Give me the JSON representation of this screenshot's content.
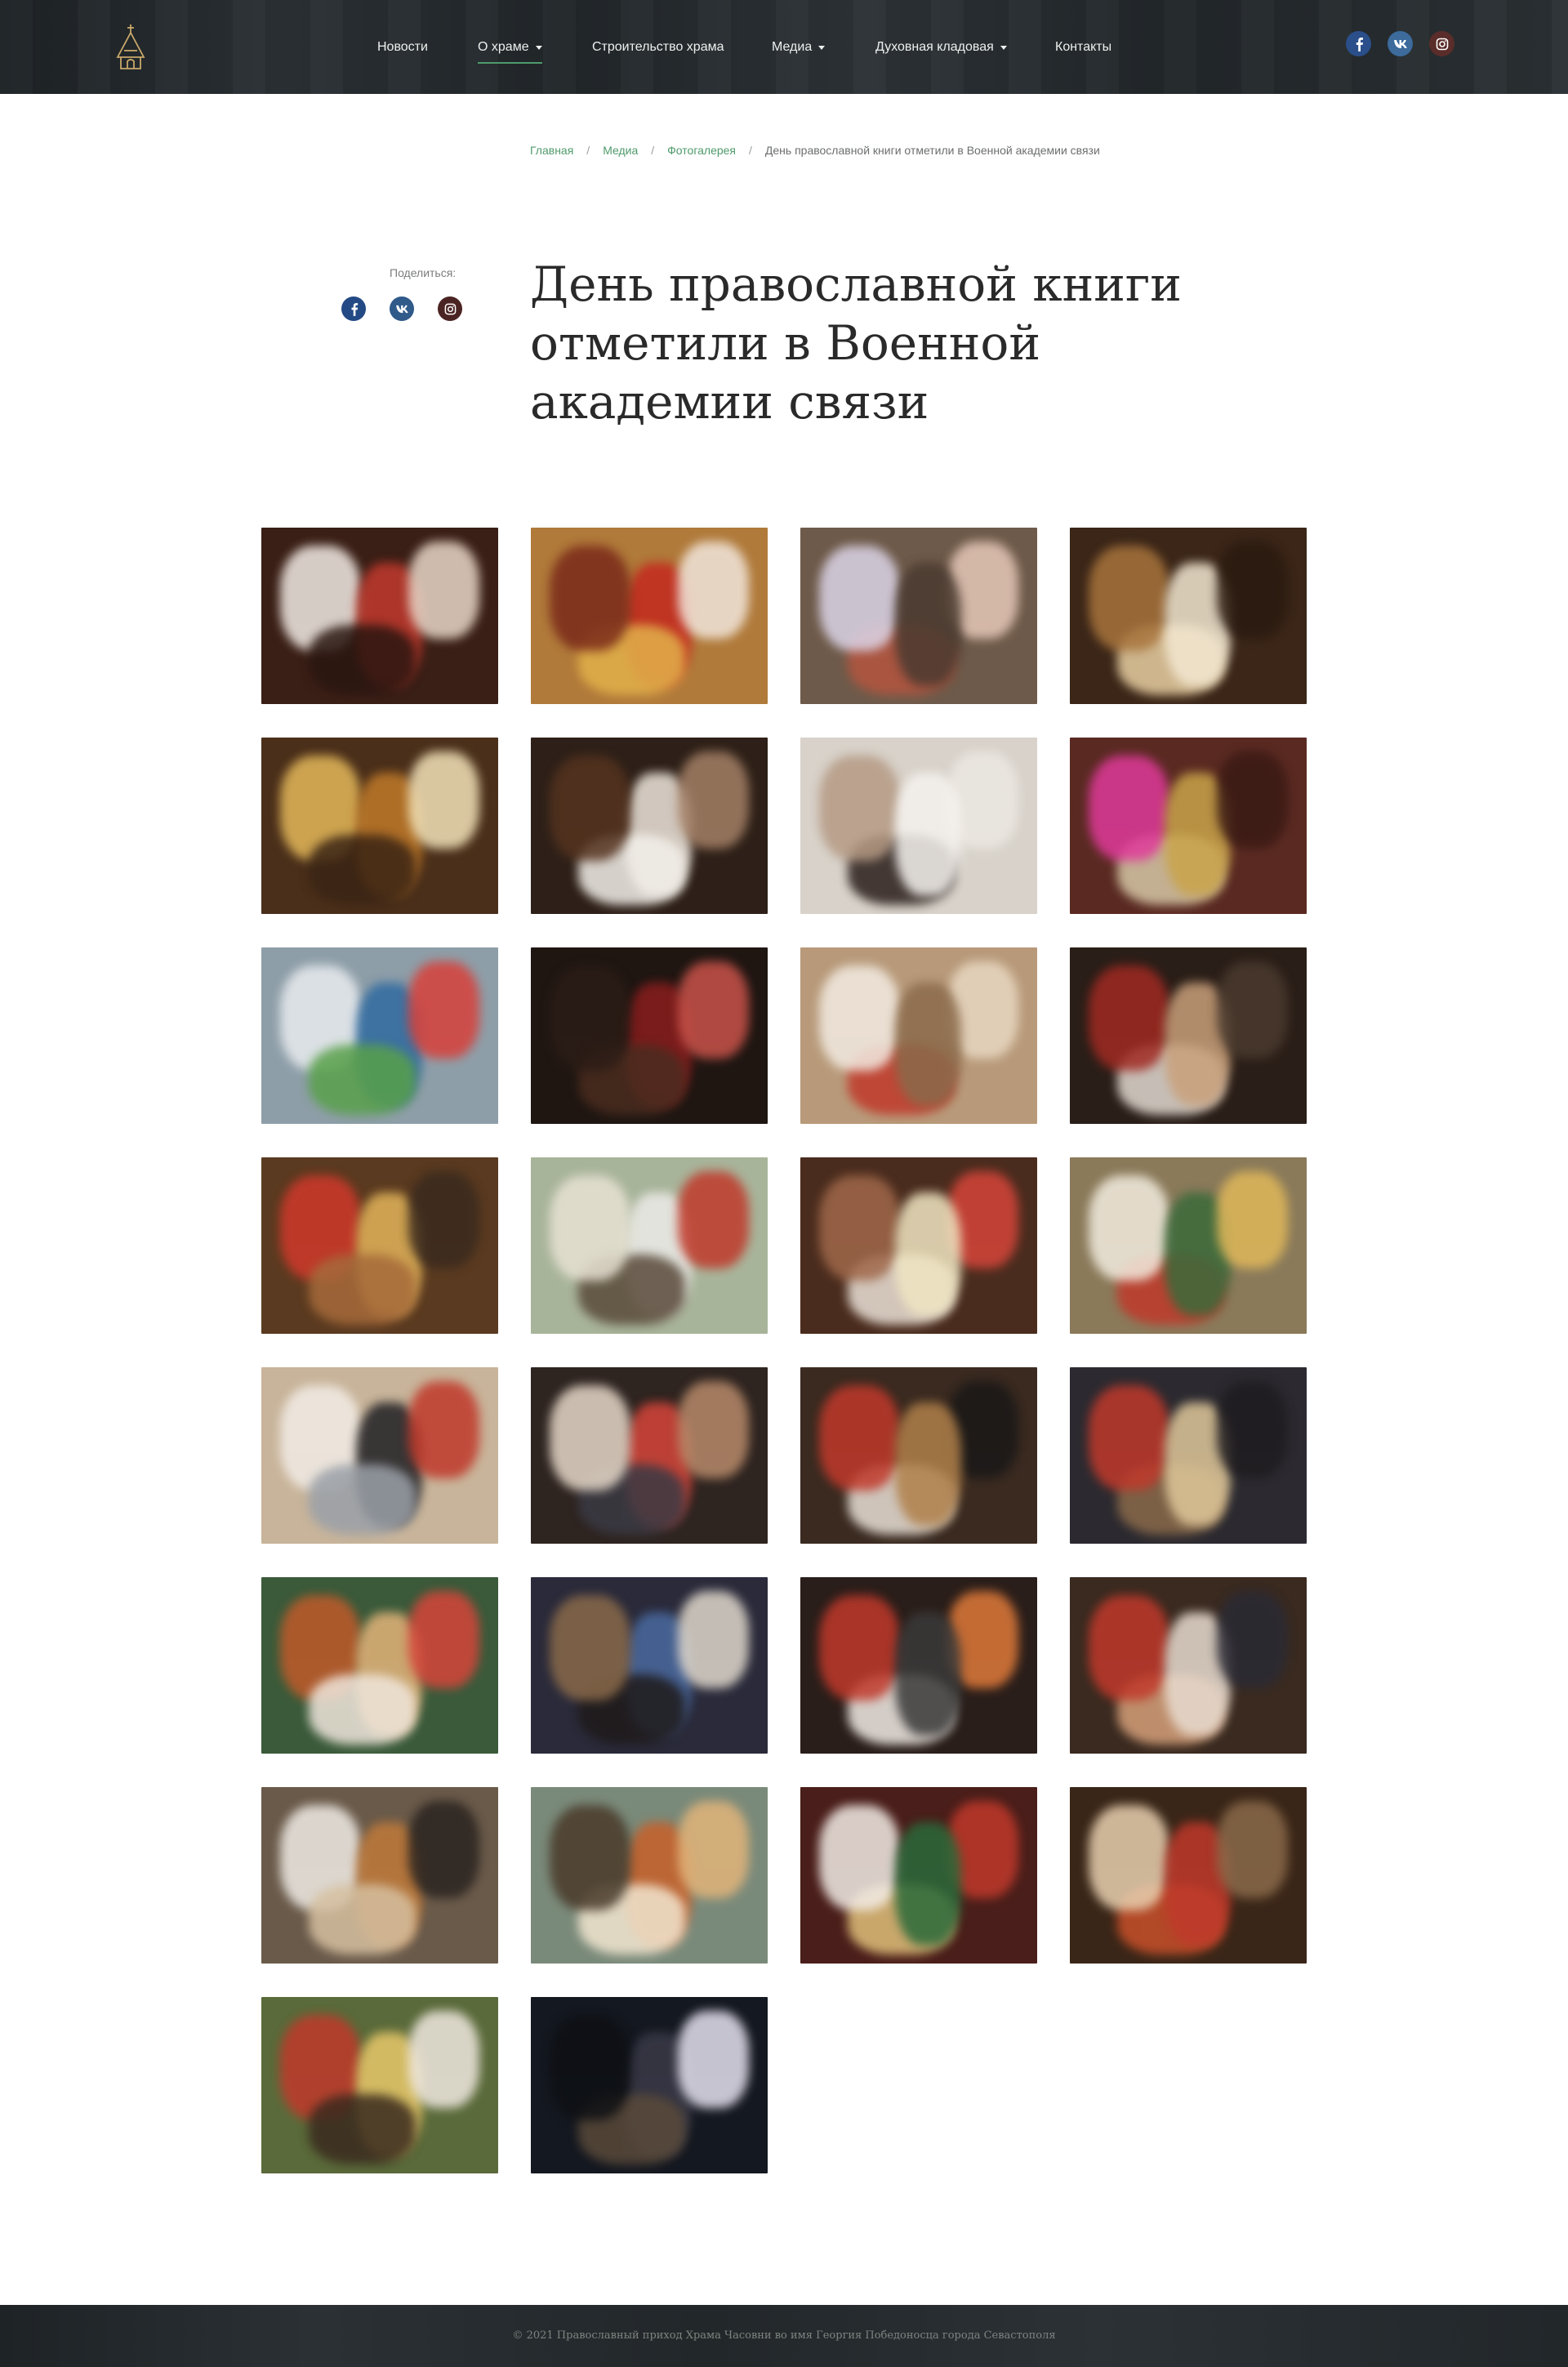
{
  "header": {
    "logo_icon": "church-logo-icon",
    "nav": [
      {
        "label": "Новости",
        "has_dropdown": false,
        "active": false
      },
      {
        "label": "О храме",
        "has_dropdown": true,
        "active": true
      },
      {
        "label": "Строительство храма",
        "has_dropdown": false,
        "active": false
      },
      {
        "label": "Медиа",
        "has_dropdown": true,
        "active": false
      },
      {
        "label": "Духовная кладовая",
        "has_dropdown": true,
        "active": false
      },
      {
        "label": "Контакты",
        "has_dropdown": false,
        "active": false
      }
    ],
    "social": [
      "facebook-icon",
      "vk-icon",
      "instagram-icon"
    ]
  },
  "breadcrumb": {
    "items": [
      "Главная",
      "Медиа",
      "Фотогалерея"
    ],
    "current": "День православной книги отметили в Военной академии связи",
    "separator": "/"
  },
  "share": {
    "label": "Поделиться:",
    "icons": [
      "facebook-icon",
      "vk-icon",
      "instagram-icon"
    ]
  },
  "page_title": "День православной книги отметили в Военной академии связи",
  "gallery": {
    "count": 30,
    "photos": [
      {
        "bg": "#3a1f16",
        "spots": [
          "#f3ece6",
          "#c23a2e",
          "#e9d7c8",
          "#2a1610"
        ]
      },
      {
        "bg": "#b07a3a",
        "spots": [
          "#c4281f",
          "#f1e6dc",
          "#e2b14a",
          "#7a2a1a"
        ]
      },
      {
        "bg": "#6e5a4a",
        "spots": [
          "#e6c8b8",
          "#b4553f",
          "#dcd5e8",
          "#4a3a30"
        ]
      },
      {
        "bg": "#3b2618",
        "spots": [
          "#e8cfa2",
          "#a8743c",
          "#f3e8d2",
          "#2a1a10"
        ]
      },
      {
        "bg": "#4a2f1a",
        "spots": [
          "#e4b85a",
          "#c07a2a",
          "#f2e2b8",
          "#3a2414"
        ]
      },
      {
        "bg": "#2e2018",
        "spots": [
          "#eee6dc",
          "#a48066",
          "#f3f0ea",
          "#55331f"
        ]
      },
      {
        "bg": "#d8d2ca",
        "spots": [
          "#ece8e2",
          "#2a1e1a",
          "#b59a84",
          "#f5f2ee"
        ]
      },
      {
        "bg": "#5a2a22",
        "spots": [
          "#d6c7a6",
          "#e03a9a",
          "#c9a44a",
          "#3a1a14"
        ]
      },
      {
        "bg": "#8e9ea8",
        "spots": [
          "#e9ecef",
          "#2f6aa0",
          "#d8403a",
          "#58a04a"
        ]
      },
      {
        "bg": "#1f1612",
        "spots": [
          "#8a1e1e",
          "#c9534a",
          "#4a2c1f",
          "#2b1c16"
        ]
      },
      {
        "bg": "#b89a7a",
        "spots": [
          "#e8d8c2",
          "#c0392b",
          "#f2ebe2",
          "#8a6a4a"
        ]
      },
      {
        "bg": "#2a1e18",
        "spots": [
          "#e2dad2",
          "#a02a22",
          "#c9a07a",
          "#4a3a2e"
        ]
      },
      {
        "bg": "#5a3a20",
        "spots": [
          "#d0392b",
          "#e2b45a",
          "#3a2a1e",
          "#a66a3a"
        ]
      },
      {
        "bg": "#a8b49a",
        "spots": [
          "#ecebe8",
          "#c0392b",
          "#5a4a3a",
          "#e8e2d4"
        ]
      },
      {
        "bg": "#4a2c1e",
        "spots": [
          "#d6453a",
          "#eae0d6",
          "#a0684a",
          "#f0e6c2"
        ]
      },
      {
        "bg": "#8a7a5a",
        "spots": [
          "#c0392b",
          "#f2ecdf",
          "#3a6a3a",
          "#e0b85a"
        ]
      },
      {
        "bg": "#c8b49a",
        "spots": [
          "#f2ece6",
          "#1f1f24",
          "#c0392b",
          "#9aa0a8"
        ]
      },
      {
        "bg": "#2e2420",
        "spots": [
          "#d6453a",
          "#b88a6a",
          "#3a3a44",
          "#e6d8c8"
        ]
      },
      {
        "bg": "#3a2a20",
        "spots": [
          "#1a1818",
          "#e8e0d6",
          "#c0392b",
          "#b0804a"
        ]
      },
      {
        "bg": "#2c2a30",
        "spots": [
          "#8a6a4a",
          "#c0392b",
          "#e0c89a",
          "#1f1c20"
        ]
      },
      {
        "bg": "#3a5a3a",
        "spots": [
          "#c05a2a",
          "#e4b47a",
          "#d6453a",
          "#f0e6dc"
        ]
      },
      {
        "bg": "#2a2a3a",
        "spots": [
          "#4a6aa0",
          "#e0d8cc",
          "#1f1a1a",
          "#8a6a4a"
        ]
      },
      {
        "bg": "#2a1e1a",
        "spots": [
          "#e07a3a",
          "#f2ece6",
          "#c0392b",
          "#3a3a3a"
        ]
      },
      {
        "bg": "#3a2a20",
        "spots": [
          "#d6a07a",
          "#c0392b",
          "#e8dcd0",
          "#2a2a34"
        ]
      },
      {
        "bg": "#6a5a4a",
        "spots": [
          "#f0ece6",
          "#c07a3a",
          "#2a2420",
          "#d6c0a0"
        ]
      },
      {
        "bg": "#7a8a7a",
        "spots": [
          "#c8602a",
          "#e2b47a",
          "#f2e6d0",
          "#4a3a2a"
        ]
      },
      {
        "bg": "#4a1e1a",
        "spots": [
          "#c0392b",
          "#e0c07a",
          "#f2ece6",
          "#2a6a3a"
        ]
      },
      {
        "bg": "#3a2618",
        "spots": [
          "#c8502a",
          "#e8d0b0",
          "#c0392b",
          "#8a6a4a"
        ]
      },
      {
        "bg": "#5a6a3a",
        "spots": [
          "#c0392b",
          "#e8c86a",
          "#f0e8e0",
          "#3a2a1e"
        ]
      },
      {
        "bg": "#141820",
        "spots": [
          "#3a3a48",
          "#e6e2f0",
          "#5a4a3a",
          "#0e1014"
        ]
      }
    ]
  },
  "footer": {
    "text": "© 2021 Православный приход Храма Часовни во имя Георгия Победоносца города Севастополя"
  }
}
